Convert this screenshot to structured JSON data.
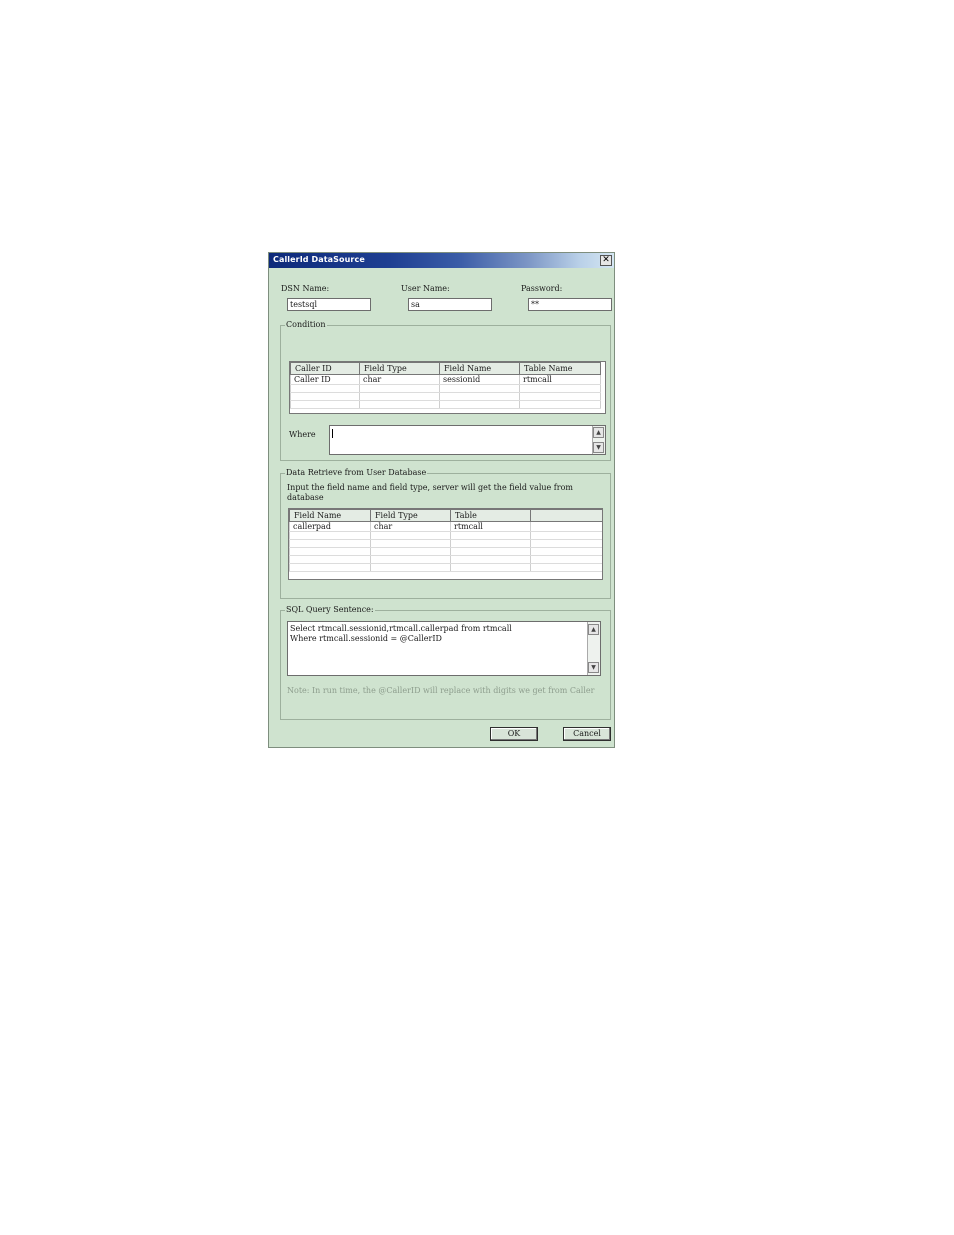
{
  "window": {
    "title": "CallerId DataSource",
    "close_glyph": "✕"
  },
  "connection": {
    "dsn_label": "DSN Name:",
    "dsn_value": "testsql",
    "user_label": "User Name:",
    "user_value": "sa",
    "password_label": "Password:",
    "password_value": "**"
  },
  "condition": {
    "group_title": "Condition",
    "columns": [
      "Caller ID",
      "Field Type",
      "Field Name",
      "Table Name"
    ],
    "rows": [
      [
        "Caller ID",
        "char",
        "sessionid",
        "rtmcall"
      ]
    ],
    "where_label": "Where",
    "where_value": ""
  },
  "retrieve": {
    "group_title": "Data Retrieve from User Database",
    "description": "Input the field name and field type, server will get the field value from database",
    "columns": [
      "Field Name",
      "Field Type",
      "Table",
      ""
    ],
    "rows": [
      [
        "callerpad",
        "char",
        "rtmcall",
        ""
      ]
    ]
  },
  "sql": {
    "group_title": "SQL Query Sentence:",
    "line1": "Select  rtmcall.sessionid,rtmcall.callerpad from rtmcall",
    "line2": "Where rtmcall.sessionid = @CallerID",
    "note": "Note: In run time, the @CallerID will replace with digits we get from Caller"
  },
  "buttons": {
    "ok": "OK",
    "cancel": "Cancel"
  },
  "icons": {
    "scroll_up": "up-arrow-icon",
    "scroll_down": "down-arrow-icon"
  }
}
